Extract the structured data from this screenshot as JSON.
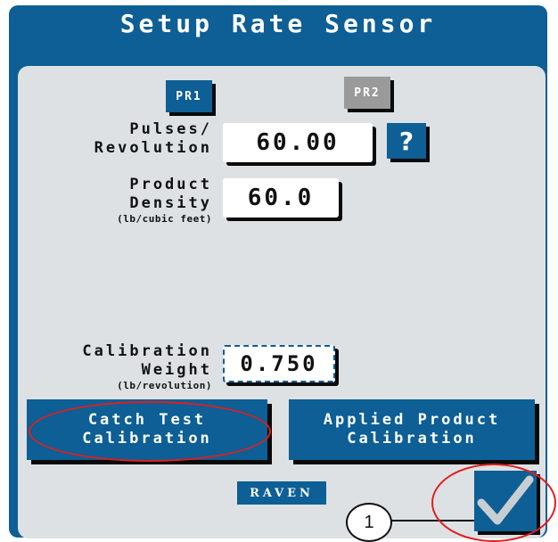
{
  "header": {
    "title": "Setup Rate Sensor"
  },
  "tabs": [
    {
      "label": "PR1",
      "active": true
    },
    {
      "label": "PR2",
      "active": false
    }
  ],
  "fields": {
    "pulses": {
      "label_line1": "Pulses/",
      "label_line2": "Revolution",
      "value": "60.00"
    },
    "density": {
      "label_line1": "Product",
      "label_line2": "Density",
      "unit": "(lb/cubic feet)",
      "value": "60.0"
    },
    "calibration": {
      "label_line1": "Calibration",
      "label_line2": "Weight",
      "unit": "(lb/revolution)",
      "value": "0.750"
    }
  },
  "help_button": {
    "label": "?"
  },
  "buttons": {
    "catch_test": {
      "line1": "Catch Test",
      "line2": "Calibration"
    },
    "applied_product": {
      "line1": "Applied Product",
      "line2": "Calibration"
    }
  },
  "logo": {
    "text": "RAVEN"
  },
  "callout": {
    "number": "1"
  },
  "confirm_icon": "checkmark-icon",
  "colors": {
    "primary_blue": "#0d5f95",
    "panel_gray": "#dde1e4",
    "disabled_tab": "#9a9a9a",
    "annotation_red": "#e01e1e"
  }
}
